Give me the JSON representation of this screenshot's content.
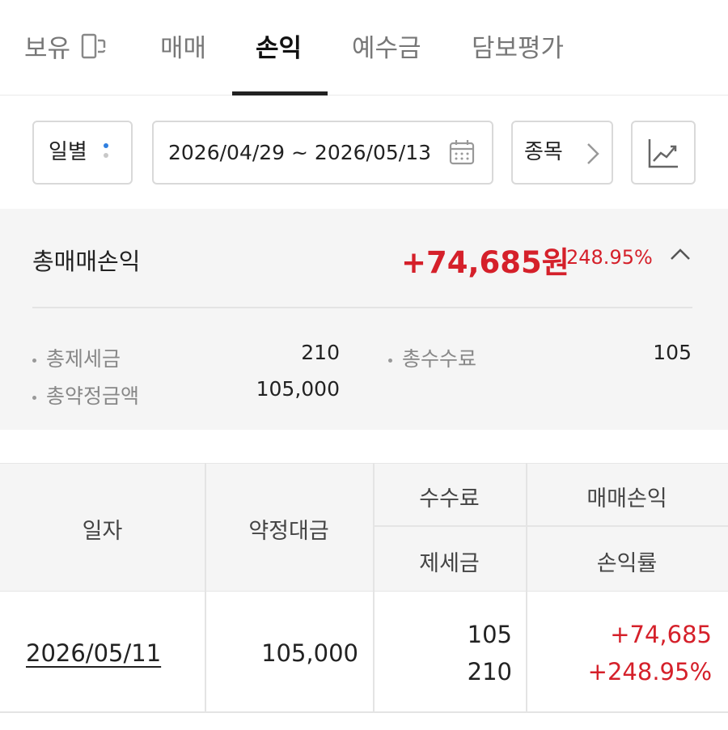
{
  "tabs": [
    {
      "label": "보유",
      "active": false
    },
    {
      "label": "매매",
      "active": false
    },
    {
      "label": "손익",
      "active": true
    },
    {
      "label": "예수금",
      "active": false
    },
    {
      "label": "담보평가",
      "active": false
    }
  ],
  "filters": {
    "period_label": "일별",
    "date_range": "2026/04/29 ~ 2026/05/13",
    "stock_label": "종목"
  },
  "summary": {
    "title": "총매매손익",
    "amount": "+74,685원",
    "rate": "248.95%",
    "items": [
      {
        "label": "총제세금",
        "value": "210"
      },
      {
        "label": "총수수료",
        "value": "105"
      },
      {
        "label": "총약정금액",
        "value": "105,000"
      }
    ]
  },
  "table": {
    "headers": {
      "date": "일자",
      "contract_amount": "약정대금",
      "fee": "수수료",
      "tax": "제세금",
      "pnl": "매매손익",
      "pnl_rate": "손익률"
    },
    "rows": [
      {
        "date": "2026/05/11",
        "contract_amount": "105,000",
        "fee": "105",
        "tax": "210",
        "pnl": "+74,685",
        "pnl_rate": "+248.95%"
      }
    ]
  },
  "colors": {
    "profit_red": "#d5202a",
    "accent_blue": "#2f7fe0"
  }
}
